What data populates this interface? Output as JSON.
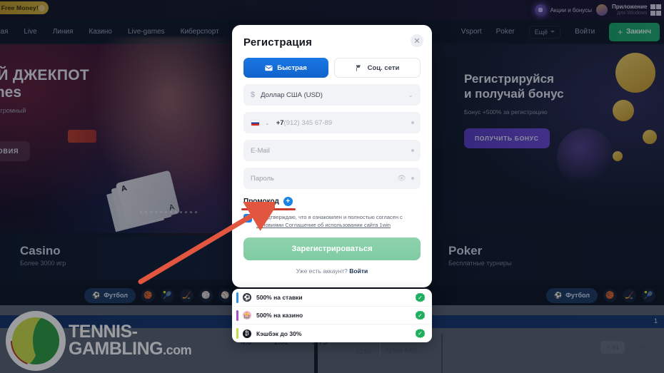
{
  "topbar": {
    "free_money_badge": "Free Money!",
    "promo_label": "Акции и бонусы",
    "app_title": "Приложение",
    "app_subtitle": "для Windows",
    "promo_icon": "gift-orb-icon",
    "avatar_icon": "avatar-icon",
    "windows_icon": "windows-logo-icon"
  },
  "nav": {
    "left_items": [
      {
        "label": "авная"
      },
      {
        "label": "Live"
      },
      {
        "label": "Линия"
      },
      {
        "label": "Казино"
      },
      {
        "label": "Live-games"
      },
      {
        "label": "Киберспорт"
      }
    ],
    "right_items": [
      {
        "label": "Vsport"
      },
      {
        "label": "Poker"
      }
    ],
    "more_label": "Ещё",
    "login_label": "Войти",
    "deposit_label": "Закинч",
    "deposit_plus": "+",
    "deposit_color": "#19a86a"
  },
  "hero_left": {
    "title_line1": "НЫЙ ДЖЕКПОТ",
    "title_line2": "Games",
    "subtitle_line1": "сорвать огромный",
    "subtitle_line2": "игроков",
    "button_label": "УСЛОВИЯ",
    "card_rank_top": "A",
    "card_rank_bottom": "A"
  },
  "hero_right": {
    "title_line1": "Регистрируйся",
    "title_line2": "и получай бонус",
    "subtitle": "Бонус +500% за регистрацию",
    "button_label": "ПОЛУЧИТЬ БОНУС",
    "button_color": "#5a3ec8"
  },
  "promo_cards": [
    {
      "title": "Casino",
      "subtitle": "Более 3000 игр"
    },
    {
      "title": "",
      "subtitle": ""
    },
    {
      "title": "Poker",
      "subtitle": "Бесплатные турниры"
    }
  ],
  "sports_strip": {
    "left_chip": "Футбол",
    "right_chip": "Футбол",
    "icons": [
      "football-icon",
      "tennis-icon",
      "basketball-icon",
      "volleyball-icon",
      "hockey-icon",
      "basketball-icon"
    ]
  },
  "betting": {
    "banner_number": "1",
    "odds": [
      "4.6",
      "1.32",
      "9.75"
    ],
    "time": "02:00",
    "league": "Кубок АФЛ",
    "more_markets": "+ 91",
    "dash": "—"
  },
  "watermark": {
    "line1": "TENNIS-",
    "line2_main": "GAMBLING",
    "line2_suffix": ".com",
    "logo_icon": "tennis-yin-yang-icon"
  },
  "modal": {
    "title": "Регистрация",
    "close_icon": "close-icon",
    "close_glyph": "✕",
    "tabs": [
      {
        "label": "Быстрая",
        "icon": "envelope-icon",
        "active": true
      },
      {
        "label": "Соц. сети",
        "icon": "social-icon",
        "active": false
      }
    ],
    "currency": {
      "symbol": "$",
      "value": "Доллар США (USD)",
      "chevron": "⌄"
    },
    "phone": {
      "flag_icon": "russia-flag-icon",
      "chevron": "⌄",
      "prefix": "+7",
      "rest": "(912) 345 67-89"
    },
    "email": {
      "placeholder": "E-Mail"
    },
    "password": {
      "placeholder": "Пароль",
      "eye_icon": "eye-icon"
    },
    "promocode": {
      "label": "Промокод",
      "plus_glyph": "+",
      "highlight_color": "#c9392c"
    },
    "agreement": {
      "checkbox_glyph": "✓",
      "text_part1": "Я подтверждаю, что я ознакомлен и полностью согласен с ",
      "link_text": "Условиями Соглашение об использовании сайта 1win"
    },
    "submit_label": "Зарегистрироваться",
    "submit_color": "#8ed3ad",
    "have_account_text": "Уже есть аккаунт?",
    "have_account_link": "Войти"
  },
  "bonus_list": [
    {
      "label": "500% на ставки",
      "icon": "football-icon",
      "bar_color": "#2f8fe0",
      "icon_bg": "#262b35",
      "check": "✓"
    },
    {
      "label": "500% на казино",
      "icon": "casino-icon",
      "bar_color": "#a24fd0",
      "icon_bg": "#f0b6c7",
      "check": "✓"
    },
    {
      "label": "Кэшбэк до 30%",
      "icon": "cashback-icon",
      "bar_color": "#c8d94a",
      "icon_bg": "#14181f",
      "check": "✓"
    }
  ],
  "annotation": {
    "arrow_color": "#e2563f",
    "arrow_name": "red-pointer-arrow"
  }
}
